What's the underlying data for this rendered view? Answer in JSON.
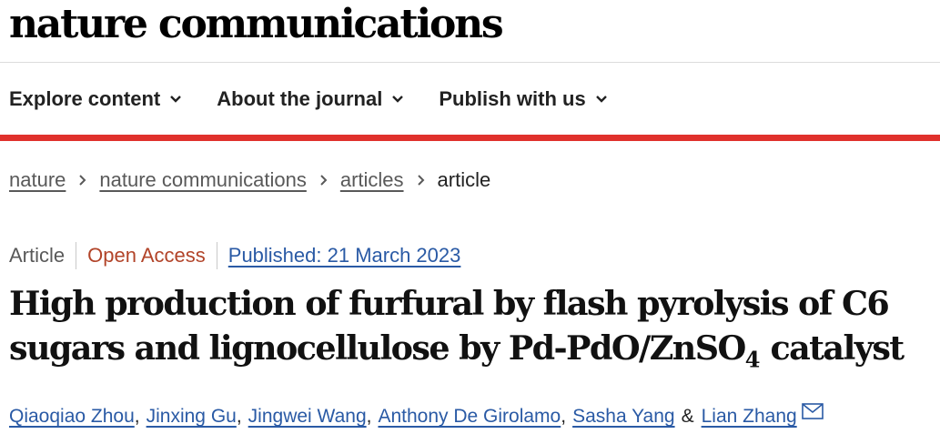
{
  "site": {
    "logo": "nature communications"
  },
  "nav": {
    "items": [
      {
        "label": "Explore content"
      },
      {
        "label": "About the journal"
      },
      {
        "label": "Publish with us"
      }
    ]
  },
  "breadcrumb": {
    "items": [
      "nature",
      "nature communications",
      "articles"
    ],
    "current": "article"
  },
  "article": {
    "type": "Article",
    "access": "Open Access",
    "published": "Published: 21 March 2023",
    "title_line1": "High production of furfural by flash pyrolysis of C6",
    "title_line2_prefix": "sugars and lignocellulose by Pd-PdO/ZnSO",
    "title_subscript": "4",
    "title_line2_suffix": " catalyst",
    "authors": [
      "Qiaoqiao Zhou",
      "Jinxing Gu",
      "Jingwei Wang",
      "Anthony De Girolamo",
      "Sasha Yang"
    ],
    "author_separator": ",",
    "amp": "&",
    "corresponding_author": "Lian Zhang",
    "corresponding_icon": "mail-icon"
  },
  "colors": {
    "accent_red": "#e0312c",
    "link_blue": "#2a5aa5",
    "open_access": "#b24429"
  }
}
